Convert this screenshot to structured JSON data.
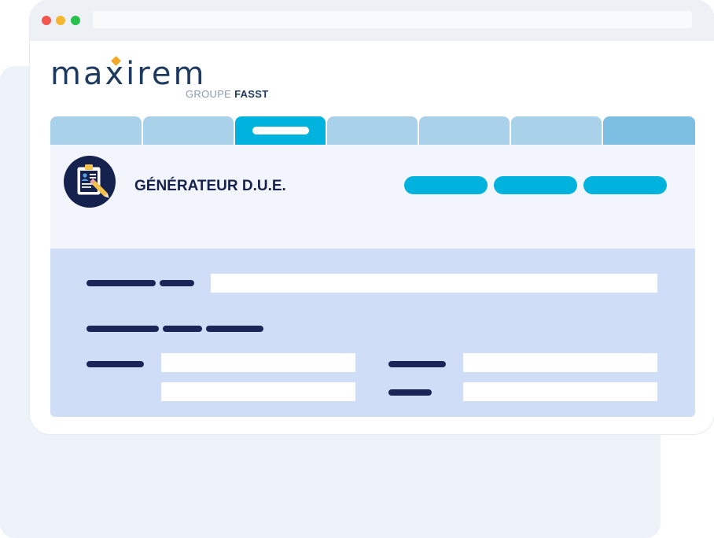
{
  "app": {
    "title": "GÉNÉRATEUR D.U.E."
  },
  "logo": {
    "wordmark_before": "ma",
    "wordmark_x": "x",
    "wordmark_after": "irem",
    "group_prefix": "GROUPE",
    "group_brand": "FASST"
  },
  "tabs": [
    {
      "name": "tab-1",
      "active": false
    },
    {
      "name": "tab-2",
      "active": false
    },
    {
      "name": "tab-3",
      "active": true
    },
    {
      "name": "tab-4",
      "active": false
    },
    {
      "name": "tab-5",
      "active": false
    },
    {
      "name": "tab-6",
      "active": false
    },
    {
      "name": "tab-7",
      "active": false
    }
  ],
  "colors": {
    "accent": "#00b3df",
    "navy": "#15224d",
    "tab_inactive": "#a9d2ea",
    "form_bg": "#cfddf7",
    "logo_orange": "#f5a623"
  },
  "icons": {
    "app_icon": "clipboard-pencil-icon"
  }
}
